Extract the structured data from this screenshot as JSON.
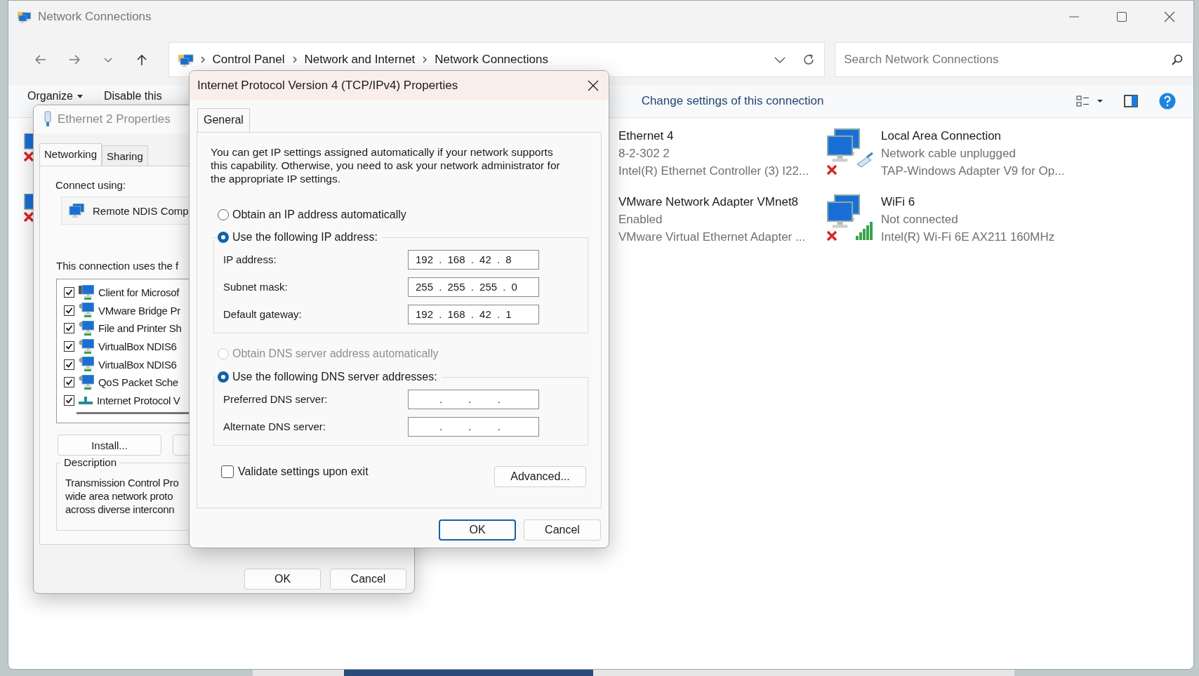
{
  "window": {
    "title": "Network Connections"
  },
  "navigation": {
    "breadcrumbs": [
      "Control Panel",
      "Network and Internet",
      "Network Connections"
    ],
    "search": {
      "placeholder": "Search Network Connections"
    }
  },
  "toolbar": {
    "items": [
      {
        "label": "Organize",
        "kind": "menu"
      },
      {
        "label": "Disable this",
        "kind": "plain"
      }
    ],
    "command": "Change settings of this connection"
  },
  "connections": [
    {
      "name": "Ethernet 4",
      "status": "8-2-302 2",
      "adapter": "Intel(R) Ethernet Controller (3) I22..."
    },
    {
      "name": "Local Area Connection",
      "status": "Network cable unplugged",
      "adapter": "TAP-Windows Adapter V9 for Op...",
      "kind": "cable",
      "disconnected": true
    },
    {
      "name": "VMware Network Adapter VMnet8",
      "status": "Enabled",
      "adapter": "VMware Virtual Ethernet Adapter ..."
    },
    {
      "name": "WiFi 6",
      "status": "Not connected",
      "adapter": "Intel(R) Wi-Fi 6E AX211 160MHz",
      "kind": "wifi",
      "disconnected": true
    }
  ],
  "ethernet_dialog": {
    "title": "Ethernet 2 Properties",
    "tabs": [
      {
        "label": "Networking",
        "selected": true
      },
      {
        "label": "Sharing",
        "selected": false
      }
    ],
    "connect_label": "Connect using:",
    "adapter": "Remote NDIS Comp",
    "components_label": "This connection uses the f",
    "components": [
      {
        "label": "Client for Microsof",
        "checked": true,
        "kind": "client"
      },
      {
        "label": "VMware Bridge Pr",
        "checked": true,
        "kind": "service"
      },
      {
        "label": "File and Printer Sh",
        "checked": true,
        "kind": "service"
      },
      {
        "label": "VirtualBox NDIS6",
        "checked": true,
        "kind": "service"
      },
      {
        "label": "VirtualBox NDIS6",
        "checked": true,
        "kind": "service"
      },
      {
        "label": "QoS Packet Sche",
        "checked": true,
        "kind": "service"
      },
      {
        "label": "Internet Protocol V",
        "checked": true,
        "kind": "protocol"
      }
    ],
    "install_button": "Install...",
    "description_label": "Description",
    "description_lines": [
      "Transmission Control Pro",
      "wide area network proto",
      "across diverse interconn"
    ],
    "buttons": [
      "OK",
      "Cancel"
    ]
  },
  "ipv4_dialog": {
    "title": "Internet Protocol Version 4 (TCP/IPv4) Properties",
    "tabs": [
      {
        "label": "General",
        "selected": true
      }
    ],
    "intro": "You can get IP settings assigned automatically if your network supports this capability. Otherwise, you need to ask your network administrator for the appropriate IP settings.",
    "ip_options": [
      {
        "label": "Obtain an IP address automatically",
        "selected": false,
        "disabled": false
      },
      {
        "label": "Use the following IP address:",
        "selected": true,
        "disabled": false
      }
    ],
    "ip_fields": [
      {
        "label": "IP address:",
        "value": "192 . 168 . 42 . 8"
      },
      {
        "label": "Subnet mask:",
        "value": "255 . 255 . 255 . 0"
      },
      {
        "label": "Default gateway:",
        "value": "192 . 168 . 42 . 1"
      }
    ],
    "dns_options": [
      {
        "label": "Obtain DNS server address automatically",
        "selected": false,
        "disabled": true
      },
      {
        "label": "Use the following DNS server addresses:",
        "selected": true,
        "disabled": false
      }
    ],
    "dns_fields": [
      {
        "label": "Preferred DNS server:",
        "value": ". . ."
      },
      {
        "label": "Alternate DNS server:",
        "value": ". . ."
      }
    ],
    "validate": {
      "label": "Validate settings upon exit",
      "checked": false
    },
    "advanced_button": "Advanced...",
    "buttons": [
      {
        "label": "OK",
        "default": true
      },
      {
        "label": "Cancel",
        "default": false
      }
    ]
  }
}
